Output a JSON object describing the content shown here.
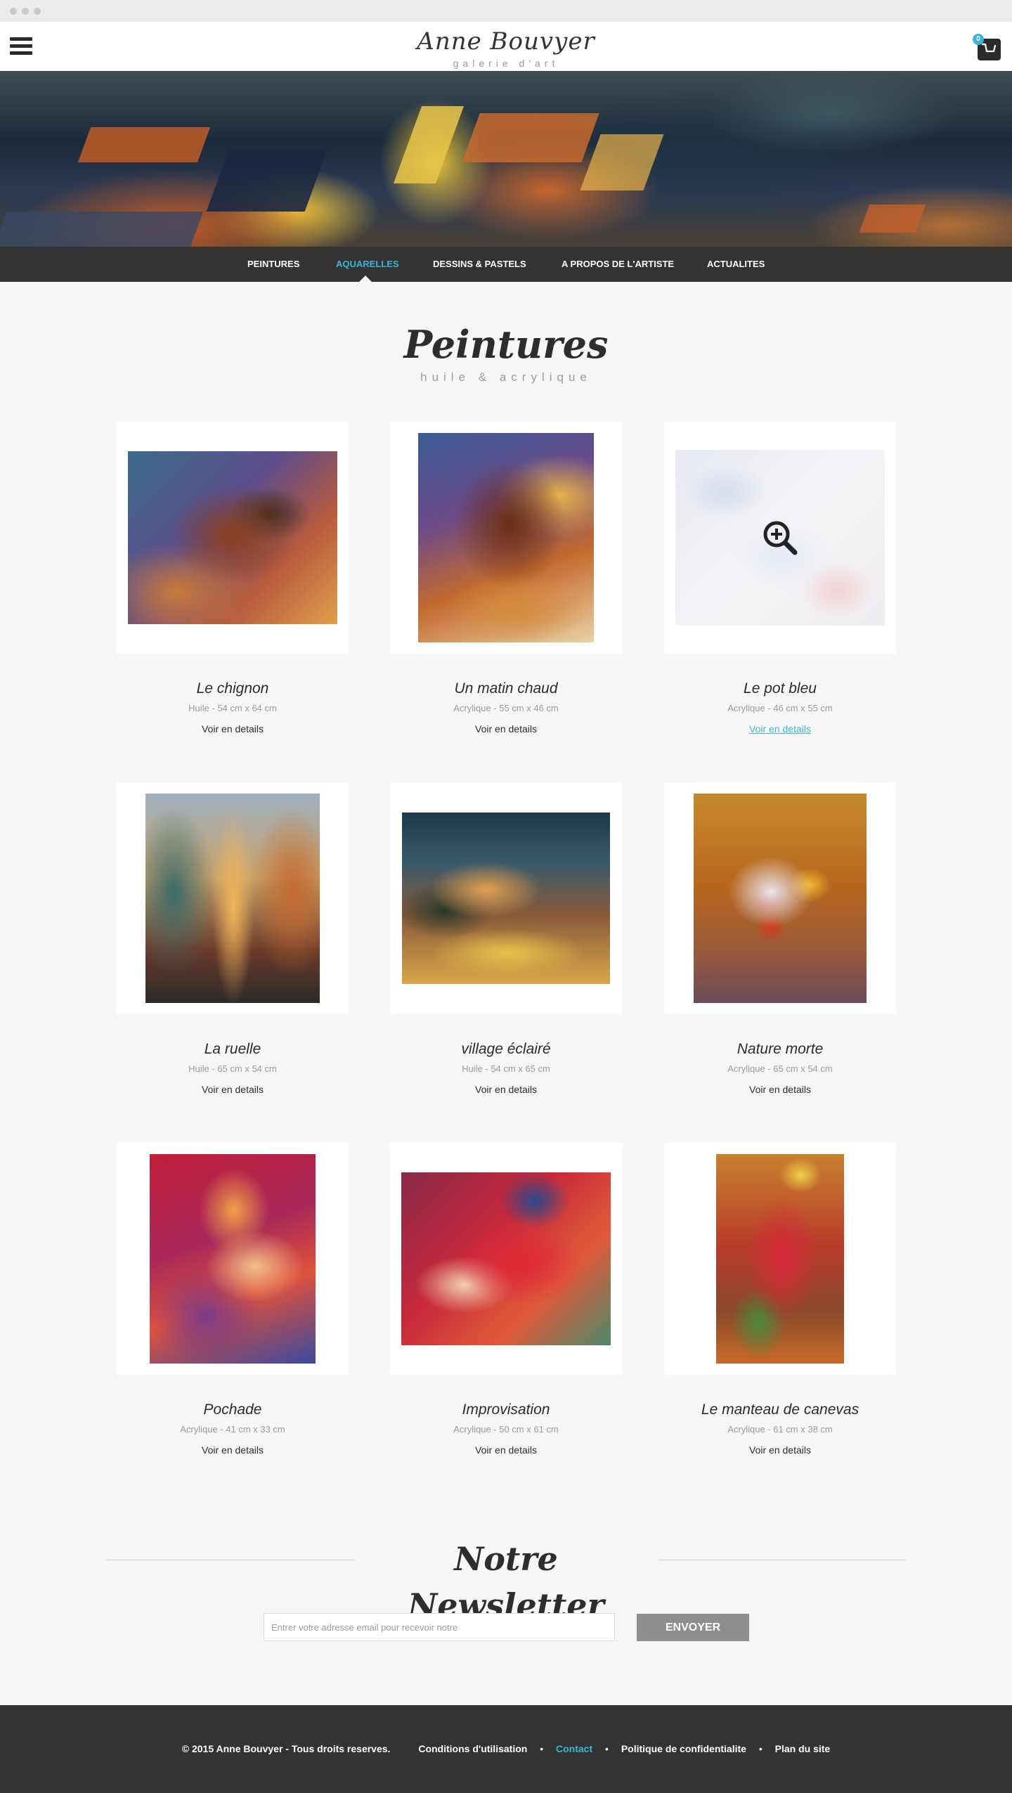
{
  "header": {
    "logo_name": "Anne Bouvyer",
    "logo_sub": "galerie d'art",
    "cart_count": "0"
  },
  "nav": {
    "items": [
      {
        "label": "PEINTURES",
        "active": false
      },
      {
        "label": "AQUARELLES",
        "active": true
      },
      {
        "label": "DESSINS & PASTELS",
        "active": false
      },
      {
        "label": "A PROPOS DE L'ARTISTE",
        "active": false
      },
      {
        "label": "ACTUALITES",
        "active": false
      }
    ]
  },
  "section": {
    "title": "Peintures",
    "subtitle": "huile & acrylique"
  },
  "gallery": [
    {
      "title": "Le chignon",
      "meta": "Huile - 54 cm x 64 cm",
      "link": "Voir en details"
    },
    {
      "title": "Un matin chaud",
      "meta": "Acrylique - 55 cm x 46 cm",
      "link": "Voir en details"
    },
    {
      "title": "Le pot bleu",
      "meta": "Acrylique - 46 cm x 55 cm",
      "link": "Voir en details",
      "hovered": true
    },
    {
      "title": "La ruelle",
      "meta": "Huile - 65 cm x 54 cm",
      "link": "Voir en details"
    },
    {
      "title": "village éclairé",
      "meta": "Huile - 54 cm x 65 cm",
      "link": "Voir en details"
    },
    {
      "title": "Nature morte",
      "meta": "Acrylique - 65 cm x 54 cm",
      "link": "Voir en details"
    },
    {
      "title": "Pochade",
      "meta": "Acrylique - 41 cm x 33 cm",
      "link": "Voir en details"
    },
    {
      "title": "Improvisation",
      "meta": "Acrylique - 50 cm x 61 cm",
      "link": "Voir en details"
    },
    {
      "title": "Le manteau de canevas",
      "meta": "Acrylique - 61 cm x 38 cm",
      "link": "Voir en details"
    }
  ],
  "newsletter": {
    "title": "Notre Newsletter",
    "placeholder": "Entrer votre adresse email pour recevoir notre",
    "button": "ENVOYER"
  },
  "footer": {
    "copyright": "© 2015 Anne Bouvyer - Tous droits reserves.",
    "links": [
      "Conditions d'utilisation",
      "Contact",
      "Politique de confidentialite",
      "Plan du site"
    ],
    "separator": "•",
    "active_link": "Contact"
  },
  "colors": {
    "accent": "#3bb7d4",
    "dark": "#333333",
    "background": "#f7f7f7",
    "button": "#8e8e8e"
  },
  "icons": [
    "hamburger-menu-icon",
    "cart-icon",
    "zoom-in-icon"
  ]
}
